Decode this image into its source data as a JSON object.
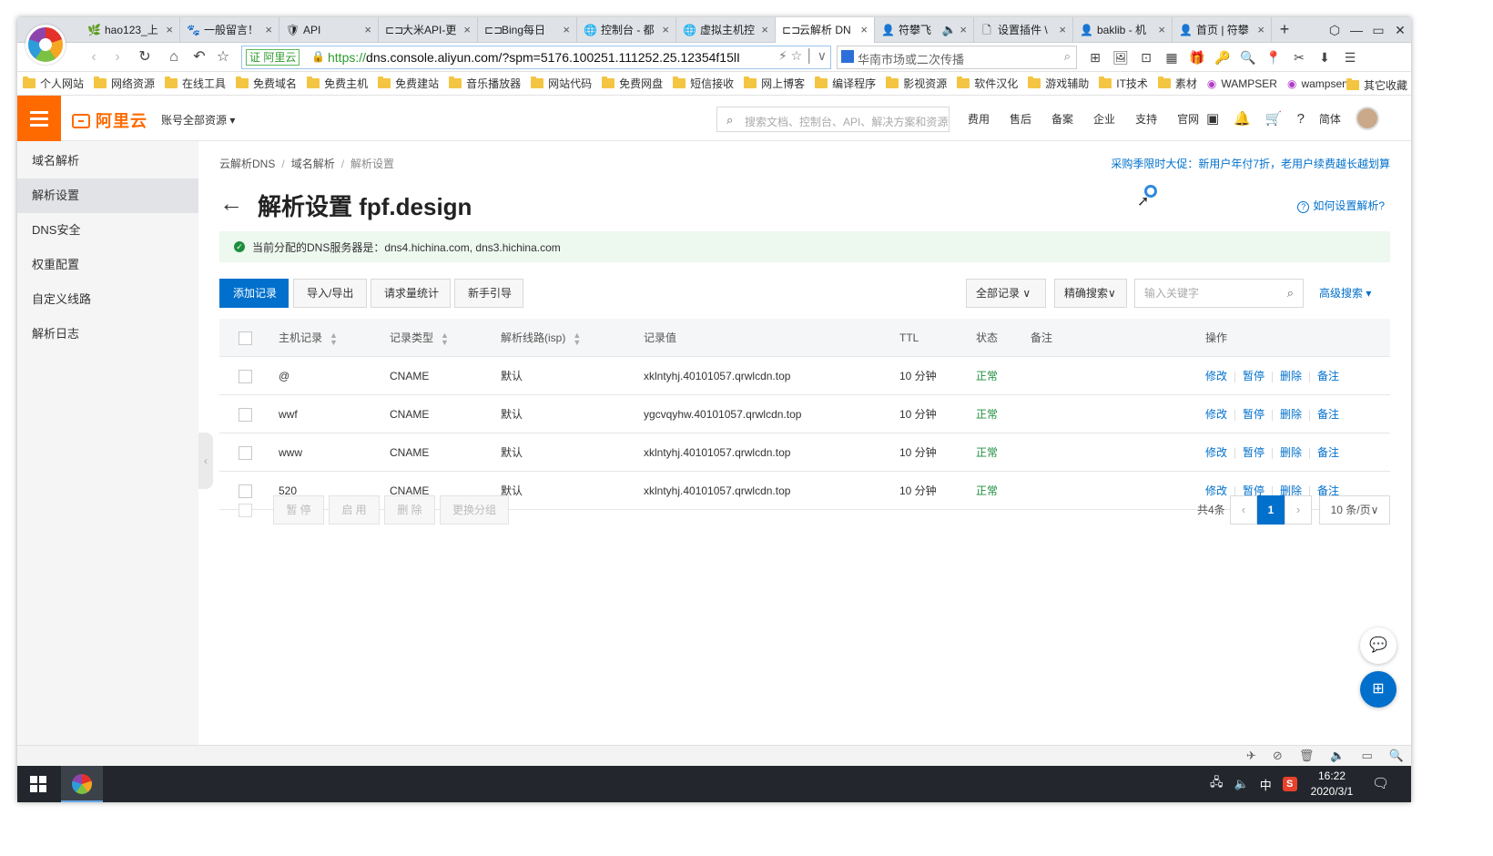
{
  "browser": {
    "tabs": [
      {
        "icon": "hao123-icon",
        "glyph": "🌿",
        "label": "hao123_上"
      },
      {
        "icon": "paw-icon",
        "glyph": "🐾",
        "label": "一般留言！"
      },
      {
        "icon": "api-shield-icon",
        "glyph": "🛡",
        "label": "API"
      },
      {
        "icon": "aliyun-icon",
        "glyph": "⊏⊐",
        "label": "大米API-更"
      },
      {
        "icon": "aliyun-icon",
        "glyph": "⊏⊐",
        "label": "Bing每日"
      },
      {
        "icon": "globe-icon",
        "glyph": "🌐",
        "label": "控制台 - 都"
      },
      {
        "icon": "globe-icon",
        "glyph": "🌐",
        "label": "虚拟主机控"
      },
      {
        "icon": "aliyun-icon",
        "glyph": "⊏⊐",
        "label": "云解析 DN",
        "active": true
      },
      {
        "icon": "avatar-icon",
        "glyph": "👤",
        "label": "符攀飞",
        "audio": "🔈"
      },
      {
        "icon": "page-icon",
        "glyph": "🗋",
        "label": "设置插件 \\"
      },
      {
        "icon": "avatar-icon",
        "glyph": "👤",
        "label": "baklib - 机"
      },
      {
        "icon": "avatar-icon",
        "glyph": "👤",
        "label": "首页 | 符攀"
      }
    ],
    "new_tab": "+",
    "window_controls": {
      "restore_icon": "⬡",
      "min": "—",
      "max": "▭",
      "close": "✕"
    },
    "tab_close": "×",
    "nav": {
      "back": "‹",
      "forward": "›",
      "reload": "↻",
      "home": "⌂",
      "undo": "↶",
      "star": "☆"
    },
    "cert_label": "证 阿里云",
    "url_proto": "https://",
    "url_rest": "dns.console.aliyun.com/?spm=5176.100251.111252.25.12354f15lI",
    "url_icons": "⚡  ☆ │ ∨",
    "search_placeholder": "华南市场或二次传播",
    "search_glass": "⌕",
    "extensions": [
      "⊞",
      "🖼",
      "⊡",
      "▦",
      "🎁",
      "🔑",
      "🔍",
      "📍",
      "✂",
      "⬇",
      "☰"
    ],
    "bookmarks": [
      {
        "type": "folder",
        "label": "个人网站"
      },
      {
        "type": "folder",
        "label": "网络资源"
      },
      {
        "type": "folder",
        "label": "在线工具"
      },
      {
        "type": "folder",
        "label": "免费域名"
      },
      {
        "type": "folder",
        "label": "免费主机"
      },
      {
        "type": "folder",
        "label": "免费建站"
      },
      {
        "type": "folder",
        "label": "音乐播放器"
      },
      {
        "type": "folder",
        "label": "网站代码"
      },
      {
        "type": "folder",
        "label": "免费网盘"
      },
      {
        "type": "folder",
        "label": "短信接收"
      },
      {
        "type": "folder",
        "label": "网上博客"
      },
      {
        "type": "folder",
        "label": "编译程序"
      },
      {
        "type": "folder",
        "label": "影视资源"
      },
      {
        "type": "folder",
        "label": "软件汉化"
      },
      {
        "type": "folder",
        "label": "游戏辅助"
      },
      {
        "type": "folder",
        "label": "IT技术"
      },
      {
        "type": "folder",
        "label": "素材"
      },
      {
        "type": "site",
        "label": "WAMPSER"
      },
      {
        "type": "site",
        "label": "wampserve"
      }
    ],
    "other_bookmarks": "其它收藏"
  },
  "console": {
    "brand": "阿里云",
    "account_scope": "账号全部资源 ▾",
    "global_search_placeholder": "搜索文档、控制台、API、解决方案和资源",
    "nav_links": [
      "费用",
      "售后",
      "备案",
      "企业",
      "支持",
      "官网"
    ],
    "nav_icons": [
      "▣",
      "🔔",
      "🛒",
      "?"
    ],
    "lang": "简体",
    "sidebar": [
      {
        "label": "域名解析"
      },
      {
        "label": "解析设置",
        "active": true
      },
      {
        "label": "DNS安全"
      },
      {
        "label": "权重配置"
      },
      {
        "label": "自定义线路"
      },
      {
        "label": "解析日志"
      }
    ],
    "sidebar_handle": "‹",
    "breadcrumb": [
      "云解析DNS",
      "域名解析",
      "解析设置"
    ],
    "breadcrumb_sep": "/",
    "promo": "采购季限时大促：新用户年付7折，老用户续费越长越划算",
    "back_arrow": "←",
    "page_title": "解析设置 fpf.design",
    "help_q": "?",
    "help_link": "如何设置解析?",
    "dns_notice": "当前分配的DNS服务器是：dns4.hichina.com, dns3.hichina.com",
    "toolbar": {
      "add": "添加记录",
      "import_export": "导入/导出",
      "stats": "请求量统计",
      "guide": "新手引导",
      "all_records": "全部记录 ∨",
      "exact_search": "精确搜索∨",
      "keyword_placeholder": "输入关键字",
      "advanced": "高级搜索 ▾"
    },
    "table": {
      "headers": {
        "host": "主机记录",
        "type": "记录类型",
        "line": "解析线路(isp)",
        "value": "记录值",
        "ttl": "TTL",
        "status": "状态",
        "remark": "备注",
        "ops": "操作"
      },
      "sort_glyph": "▲\n▼",
      "rows": [
        {
          "host": "@",
          "type": "CNAME",
          "line": "默认",
          "value": "xklntyhj.40101057.qrwlcdn.top",
          "ttl": "10 分钟",
          "status": "正常",
          "remark": ""
        },
        {
          "host": "wwf",
          "type": "CNAME",
          "line": "默认",
          "value": "ygcvqyhw.40101057.qrwlcdn.top",
          "ttl": "10 分钟",
          "status": "正常",
          "remark": ""
        },
        {
          "host": "www",
          "type": "CNAME",
          "line": "默认",
          "value": "xklntyhj.40101057.qrwlcdn.top",
          "ttl": "10 分钟",
          "status": "正常",
          "remark": ""
        },
        {
          "host": "520",
          "type": "CNAME",
          "line": "默认",
          "value": "xklntyhj.40101057.qrwlcdn.top",
          "ttl": "10 分钟",
          "status": "正常",
          "remark": ""
        }
      ],
      "row_ops": [
        "修改",
        "暂停",
        "删除",
        "备注"
      ]
    },
    "bulk": {
      "pause": "暂 停",
      "enable": "启 用",
      "delete": "删 除",
      "change_group": "更换分组"
    },
    "pagination": {
      "total": "共4条",
      "prev": "‹",
      "current": "1",
      "next": "›",
      "page_size": "10 条/页∨"
    },
    "fab_chat": "💬",
    "fab_apps": "⊞"
  },
  "statusbar_icons": [
    "✈",
    "⊘",
    "🗑",
    "🔈",
    "▭",
    "🔍"
  ],
  "taskbar": {
    "tray": [
      "🖧",
      "🔈",
      "中"
    ],
    "ime": "S",
    "time": "16:22",
    "date": "2020/3/1",
    "notify": "🗨"
  }
}
